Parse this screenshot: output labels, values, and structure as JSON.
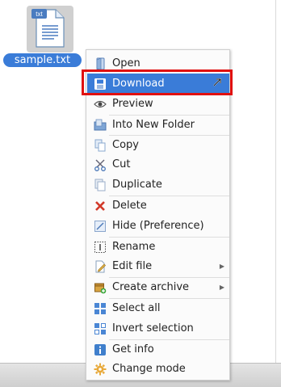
{
  "file": {
    "name": "sample.txt",
    "badge": "txt"
  },
  "menu": {
    "items": [
      {
        "label": "Open",
        "icon": "open-icon"
      },
      {
        "label": "Download",
        "icon": "download-icon",
        "active": true
      },
      {
        "label": "Preview",
        "icon": "eye-icon"
      },
      {
        "label": "Into New Folder",
        "icon": "new-folder-icon"
      },
      {
        "label": "Copy",
        "icon": "copy-icon"
      },
      {
        "label": "Cut",
        "icon": "scissors-icon"
      },
      {
        "label": "Duplicate",
        "icon": "duplicate-icon"
      },
      {
        "label": "Delete",
        "icon": "delete-icon"
      },
      {
        "label": "Hide (Preference)",
        "icon": "hide-icon"
      },
      {
        "label": "Rename",
        "icon": "rename-icon"
      },
      {
        "label": "Edit file",
        "icon": "edit-file-icon",
        "submenu": true
      },
      {
        "label": "Create archive",
        "icon": "archive-icon",
        "submenu": true
      },
      {
        "label": "Select all",
        "icon": "select-all-icon"
      },
      {
        "label": "Invert selection",
        "icon": "invert-selection-icon"
      },
      {
        "label": "Get info",
        "icon": "info-icon"
      },
      {
        "label": "Change mode",
        "icon": "gear-icon"
      }
    ]
  },
  "colors": {
    "selection": "#3a7cd8",
    "highlight_box": "#e01010"
  }
}
